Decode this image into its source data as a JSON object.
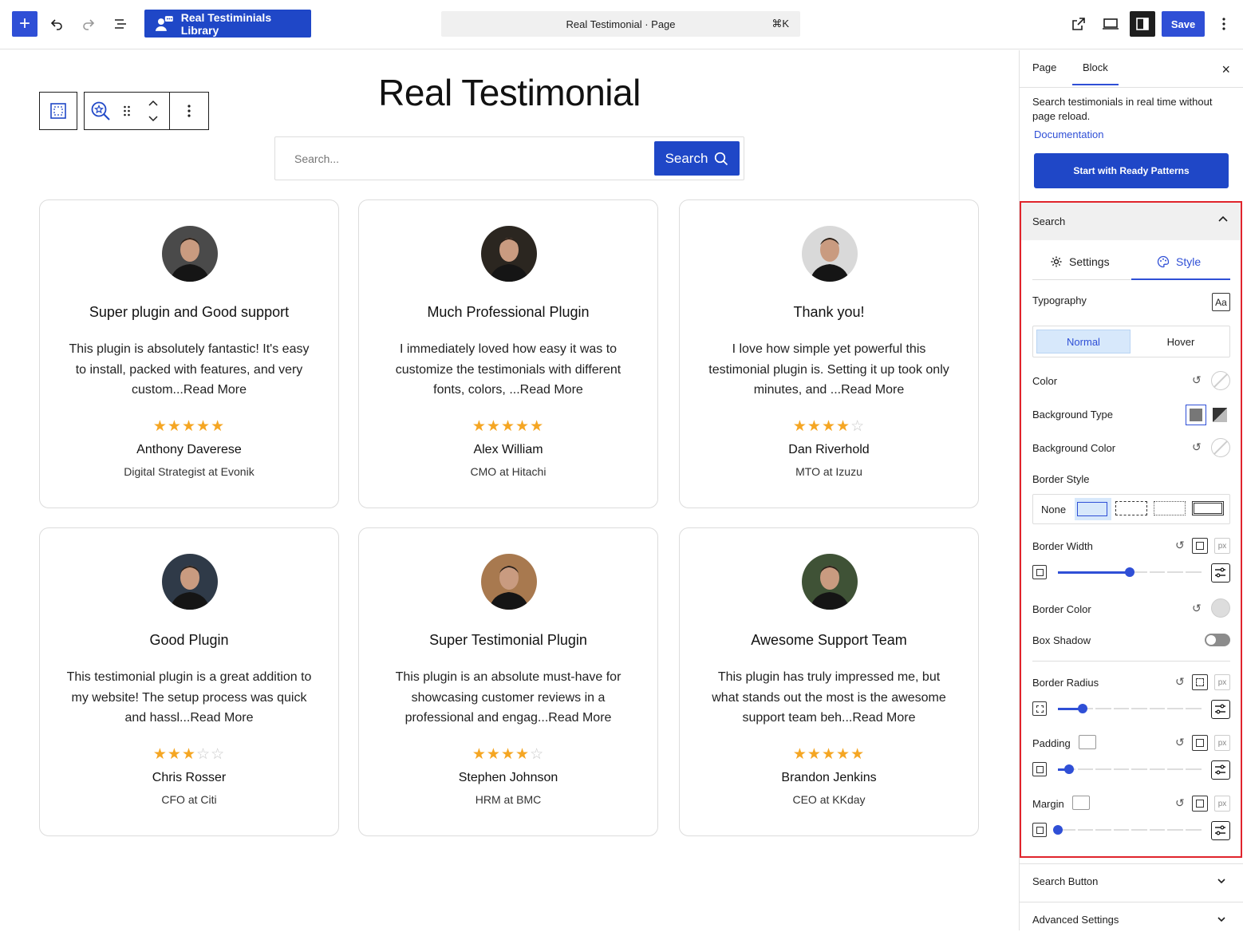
{
  "topbar": {
    "add_label": "+",
    "library_label": "Real Testiminials Library",
    "command_title": "Real Testimonial · Page",
    "command_shortcut": "⌘K",
    "save_label": "Save"
  },
  "canvas": {
    "page_title": "Real Testimonial",
    "search_placeholder": "Search...",
    "search_button": "Search"
  },
  "testimonials": [
    {
      "title": "Super plugin and Good support",
      "text": "This plugin is absolutely fantastic! It's easy to install, packed with features, and very custom...Read More",
      "rating": 5,
      "name": "Anthony Daverese",
      "role": "Digital Strategist at Evonik",
      "avatar_bg": "#4a4a4a"
    },
    {
      "title": "Much Professional Plugin",
      "text": "I immediately loved how easy it was to customize the testimonials with different fonts, colors, ...Read More",
      "rating": 5,
      "name": "Alex William",
      "role": "CMO at Hitachi",
      "avatar_bg": "#2b2620"
    },
    {
      "title": "Thank you!",
      "text": "I love how simple yet powerful this testimonial plugin is. Setting it up took only minutes, and ...Read More",
      "rating": 4,
      "name": "Dan Riverhold",
      "role": "MTO at Izuzu",
      "avatar_bg": "#d9d9d9"
    },
    {
      "title": "Good Plugin",
      "text": "This testimonial plugin is a great addition to my website! The setup process was quick and hassl...Read More",
      "rating": 3,
      "name": "Chris Rosser",
      "role": "CFO at Citi",
      "avatar_bg": "#2f3a48"
    },
    {
      "title": "Super Testimonial Plugin",
      "text": "This plugin is an absolute must-have for showcasing customer reviews in a professional and engag...Read More",
      "rating": 4,
      "name": "Stephen Johnson",
      "role": "HRM at BMC",
      "avatar_bg": "#a8794f"
    },
    {
      "title": "Awesome Support Team",
      "text": "This plugin has truly impressed me, but what stands out the most is the awesome support team beh...Read More",
      "rating": 5,
      "name": "Brandon Jenkins",
      "role": "CEO at KKday",
      "avatar_bg": "#3f5236"
    }
  ],
  "sidebar": {
    "tab_page": "Page",
    "tab_block": "Block",
    "close": "×",
    "description": "Search testimonials in real time without page reload.",
    "documentation": "Documentation",
    "patterns_button": "Start with Ready Patterns",
    "panel_title": "Search",
    "subtab_settings": "Settings",
    "subtab_style": "Style",
    "typography": "Typography",
    "state_normal": "Normal",
    "state_hover": "Hover",
    "color": "Color",
    "background_type": "Background Type",
    "background_color": "Background Color",
    "border_style": "Border Style",
    "border_none": "None",
    "border_width": "Border Width",
    "border_color": "Border Color",
    "box_shadow": "Box Shadow",
    "border_radius": "Border Radius",
    "padding": "Padding",
    "margin": "Margin",
    "unit": "px",
    "search_button_panel": "Search Button",
    "advanced_settings": "Advanced Settings"
  },
  "sliders": {
    "border_width": 0.5,
    "border_radius": 0.17,
    "padding": 0.08,
    "margin": 0.0
  },
  "colors": {
    "accent": "#2f4fd6",
    "star": "#f5a623",
    "highlight": "#e0242c"
  }
}
